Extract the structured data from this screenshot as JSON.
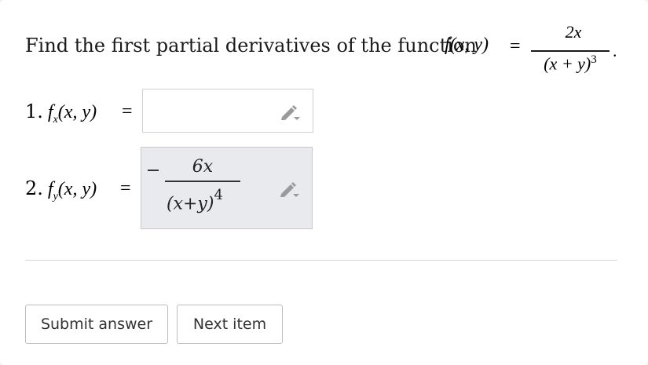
{
  "question": {
    "prompt": "Find the first partial derivatives of the function",
    "function_lhs": "f(x, y)",
    "equals": "=",
    "numerator": "2x",
    "denominator_base": "(x + y)",
    "denominator_exp": "3",
    "end_mark": "."
  },
  "items": [
    {
      "number": "1.",
      "func": "f",
      "subscript": "x",
      "args": "(x, y)",
      "equals": "=",
      "answer": ""
    },
    {
      "number": "2.",
      "func": "f",
      "subscript": "y",
      "args": "(x, y)",
      "equals": "=",
      "answer_sign": "−",
      "answer_numerator": "6x",
      "answer_denominator_base": "(x+y)",
      "answer_denominator_exp": "4"
    }
  ],
  "buttons": {
    "submit_label": "Submit answer",
    "next_label": "Next item"
  },
  "icons": {
    "edit": "pencil-icon"
  },
  "colors": {
    "filled_box_bg": "#e8eaed",
    "pencil": "#9a9a9a"
  }
}
